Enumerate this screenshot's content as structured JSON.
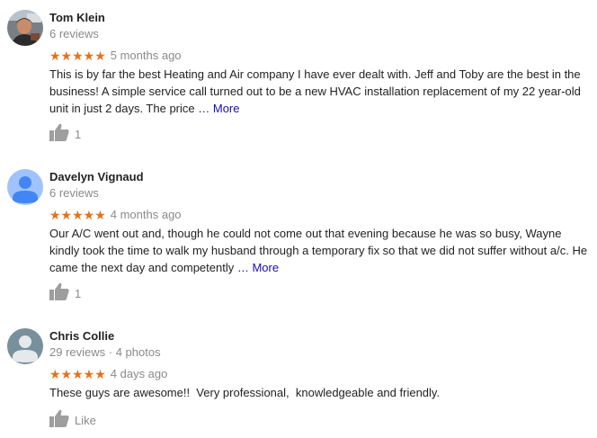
{
  "reviews": [
    {
      "name": "Tom Klein",
      "meta": "6 reviews",
      "stars": "★★★★★",
      "time": "5 months ago",
      "text": "This is by far the best Heating and Air company I have ever dealt with. Jeff and Toby are the best in the business! A simple service call turned out to be a new HVAC installation replacement of my 22 year-old unit in just 2 days. The price",
      "more_label": "… More",
      "likes": "1",
      "avatar": "photo-avatar"
    },
    {
      "name": "Davelyn Vignaud",
      "meta": "6 reviews",
      "stars": "★★★★★",
      "time": "4 months ago",
      "text": "Our A/C went out and, though he could not come out that evening because he was so busy, Wayne kindly took the time to walk my husband through a temporary fix so that we did not suffer without a/c. He came the next day and competently",
      "more_label": "… More",
      "likes": "1",
      "avatar": "default-avatar-blue"
    },
    {
      "name": "Chris Collie",
      "meta": "29 reviews · 4 photos",
      "stars": "★★★★★",
      "time": "4 days ago",
      "text": "These guys are awesome!!  Very professional,  knowledgeable and friendly.",
      "likes": "Like",
      "avatar": "default-avatar-gray"
    }
  ],
  "colors": {
    "star": "#e7711b",
    "link": "#1a0dab",
    "secondary_text": "#8a8a8a",
    "thumb": "#9e9e9e"
  }
}
